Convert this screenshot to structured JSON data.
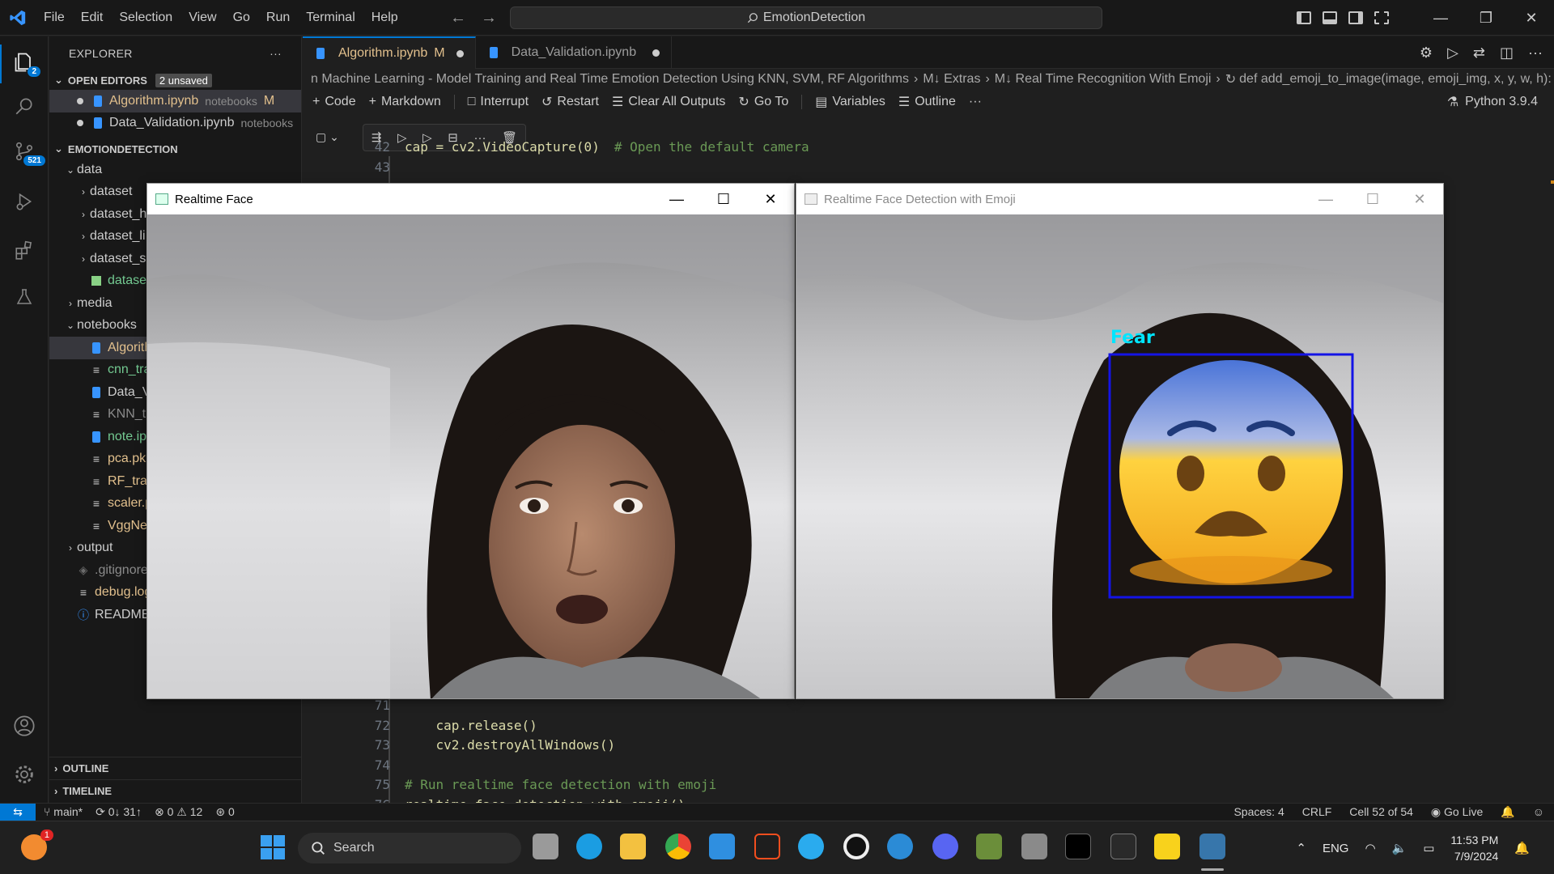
{
  "titlebar": {
    "menu": [
      "File",
      "Edit",
      "Selection",
      "View",
      "Go",
      "Run",
      "Terminal",
      "Help"
    ],
    "search_text": "EmotionDetection"
  },
  "activity": {
    "explorer_badge": "2",
    "scm_badge": "521"
  },
  "sidebar": {
    "title": "EXPLORER",
    "open_editors_label": "OPEN EDITORS",
    "unsaved_badge": "2 unsaved",
    "open_editors": [
      {
        "name": "Algorithm.ipynb",
        "folder": "notebooks",
        "status": "M"
      },
      {
        "name": "Data_Validation.ipynb",
        "folder": "notebooks",
        "status": ""
      }
    ],
    "project_label": "EMOTIONDETECTION",
    "tree": [
      {
        "label": "data",
        "depth": 1,
        "kind": "folder-open"
      },
      {
        "label": "dataset",
        "depth": 2,
        "kind": "folder"
      },
      {
        "label": "dataset_h",
        "depth": 2,
        "kind": "folder"
      },
      {
        "label": "dataset_li",
        "depth": 2,
        "kind": "folder"
      },
      {
        "label": "dataset_s",
        "depth": 2,
        "kind": "folder"
      },
      {
        "label": "dataset.cs",
        "depth": 2,
        "kind": "csv"
      },
      {
        "label": "media",
        "depth": 1,
        "kind": "folder"
      },
      {
        "label": "notebooks",
        "depth": 1,
        "kind": "folder-open"
      },
      {
        "label": "Algorithm",
        "depth": 2,
        "kind": "notebook-selected"
      },
      {
        "label": "cnn_train",
        "depth": 2,
        "kind": "lines"
      },
      {
        "label": "Data_Valid",
        "depth": 2,
        "kind": "notebook"
      },
      {
        "label": "KNN_train",
        "depth": 2,
        "kind": "lines-muted"
      },
      {
        "label": "note.ipyn",
        "depth": 2,
        "kind": "notebook-green"
      },
      {
        "label": "pca.pkl",
        "depth": 2,
        "kind": "lines-yellow"
      },
      {
        "label": "RF_trained",
        "depth": 2,
        "kind": "lines-yellow"
      },
      {
        "label": "scaler.pkl",
        "depth": 2,
        "kind": "lines-yellow"
      },
      {
        "label": "VggNetCN",
        "depth": 2,
        "kind": "lines-yellow"
      },
      {
        "label": "output",
        "depth": 1,
        "kind": "folder"
      },
      {
        "label": ".gitignore",
        "depth": 1,
        "kind": "git"
      },
      {
        "label": "debug.log",
        "depth": 1,
        "kind": "log"
      },
      {
        "label": "README",
        "depth": 1,
        "kind": "info"
      }
    ],
    "outline_label": "OUTLINE",
    "timeline_label": "TIMELINE"
  },
  "editor": {
    "tabs": [
      {
        "label": "Algorithm.ipynb",
        "status": "M",
        "active": true
      },
      {
        "label": "Data_Validation.ipynb",
        "status": "",
        "active": false
      }
    ],
    "breadcrumb": [
      "n Machine Learning - Model Training and Real Time Emotion Detection Using KNN, SVM, RF Algorithms",
      "M↓ Extras",
      "M↓ Real Time Recognition With Emoji",
      "def add_emoji_to_image(image, emoji_img, x, y, w, h):"
    ],
    "toolbar": [
      "Code",
      "Markdown",
      "Interrupt",
      "Restart",
      "Clear All Outputs",
      "Go To",
      "Variables",
      "Outline"
    ],
    "kernel": "Python 3.9.4",
    "code_top": [
      {
        "ln": "42",
        "code": "cap = cv2.VideoCapture(0)",
        "comment": "# Open the default camera"
      },
      {
        "ln": "43",
        "code": "",
        "comment": ""
      }
    ],
    "code_bottom": [
      {
        "ln": "71",
        "code": "",
        "comment": ""
      },
      {
        "ln": "72",
        "code": "    cap.release()",
        "comment": ""
      },
      {
        "ln": "73",
        "code": "    cv2.destroyAllWindows()",
        "comment": ""
      },
      {
        "ln": "74",
        "code": "",
        "comment": ""
      },
      {
        "ln": "75",
        "code": "",
        "comment": "# Run realtime face detection with emoji"
      },
      {
        "ln": "76",
        "code": "realtime_face_detection_with_emoji()",
        "comment": ""
      }
    ]
  },
  "windows": {
    "left_title": "Realtime Face",
    "right_title": "Realtime Face Detection with Emoji",
    "detection_label": "Fear",
    "box_color": "#1414e6",
    "label_color": "#00e5ff"
  },
  "statusbar": {
    "branch": "main*",
    "sync": "0↓ 31↑",
    "errors": "0",
    "warnings": "12",
    "ports": "0",
    "spaces": "Spaces: 4",
    "eol": "CRLF",
    "cell": "Cell 52 of 54",
    "golive": "Go Live"
  },
  "taskbar": {
    "search": "Search",
    "lang": "ENG",
    "time": "11:53 PM",
    "date": "7/9/2024",
    "notify_badge": "1"
  }
}
